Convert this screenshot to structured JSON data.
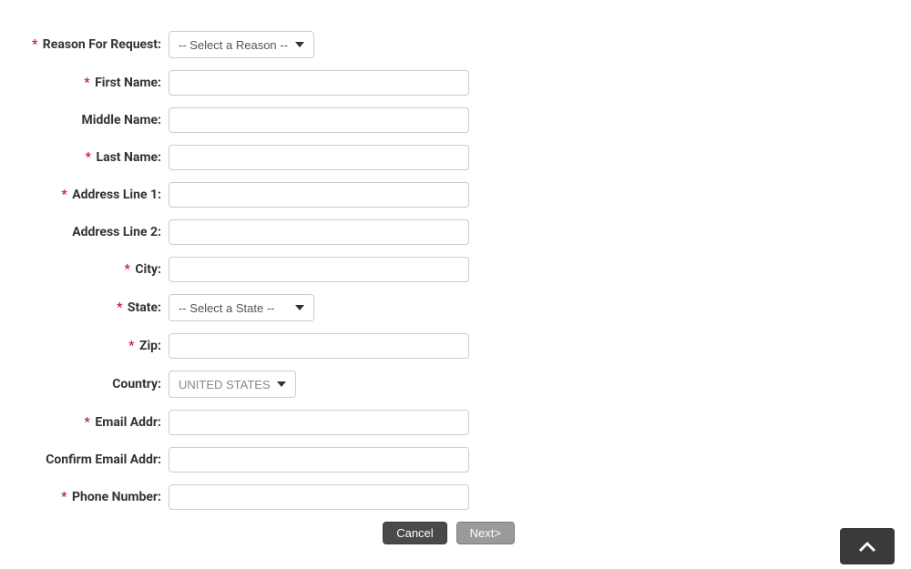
{
  "form": {
    "reason": {
      "label": "Reason For Request:",
      "required": true,
      "placeholder": "-- Select a Reason --"
    },
    "firstName": {
      "label": "First Name:",
      "required": true
    },
    "middleName": {
      "label": "Middle Name:",
      "required": false
    },
    "lastName": {
      "label": "Last Name:",
      "required": true
    },
    "address1": {
      "label": "Address Line 1:",
      "required": true
    },
    "address2": {
      "label": "Address Line 2:",
      "required": false
    },
    "city": {
      "label": "City:",
      "required": true
    },
    "state": {
      "label": "State:",
      "required": true,
      "placeholder": "-- Select a State --"
    },
    "zip": {
      "label": "Zip:",
      "required": true
    },
    "country": {
      "label": "Country:",
      "required": false,
      "value": "UNITED STATES"
    },
    "email": {
      "label": "Email Addr:",
      "required": true
    },
    "confirmEmail": {
      "label": "Confirm Email Addr:",
      "required": false
    },
    "phone": {
      "label": "Phone Number:",
      "required": true
    }
  },
  "buttons": {
    "cancel": "Cancel",
    "next": "Next>"
  },
  "requiredMarker": "*"
}
